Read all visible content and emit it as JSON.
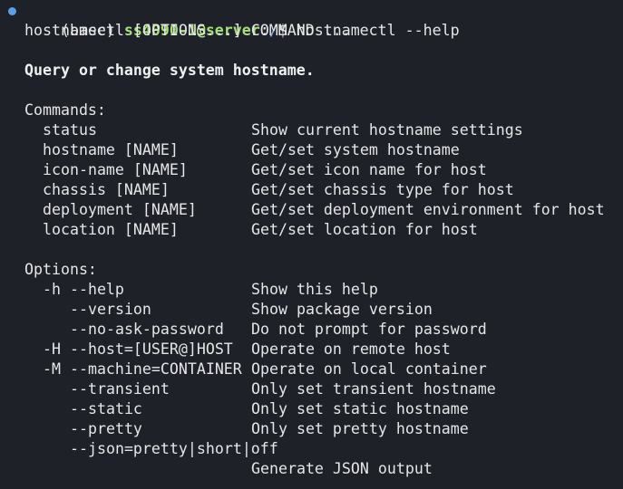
{
  "prompt": {
    "env": "(base) ",
    "user_host": "ss4090-1@server",
    "sep": ":",
    "path": "/",
    "symbol": "$ ",
    "command": "hostnamectl --help"
  },
  "usage": "hostnamectl [OPTIONS...] COMMAND ...",
  "summary": "Query or change system hostname.",
  "commands_header": "Commands:",
  "commands": [
    {
      "name": "status",
      "desc": "Show current hostname settings"
    },
    {
      "name": "hostname [NAME]",
      "desc": "Get/set system hostname"
    },
    {
      "name": "icon-name [NAME]",
      "desc": "Get/set icon name for host"
    },
    {
      "name": "chassis [NAME]",
      "desc": "Get/set chassis type for host"
    },
    {
      "name": "deployment [NAME]",
      "desc": "Get/set deployment environment for host"
    },
    {
      "name": "location [NAME]",
      "desc": "Get/set location for host"
    }
  ],
  "options_header": "Options:",
  "options": [
    {
      "name": "-h --help",
      "desc": "Show this help"
    },
    {
      "name": "--version",
      "desc": "Show package version"
    },
    {
      "name": "--no-ask-password",
      "desc": "Do not prompt for password"
    },
    {
      "name": "-H --host=[USER@]HOST",
      "desc": "Operate on remote host"
    },
    {
      "name": "-M --machine=CONTAINER",
      "desc": "Operate on local container"
    },
    {
      "name": "--transient",
      "desc": "Only set transient hostname"
    },
    {
      "name": "--static",
      "desc": "Only set static hostname"
    },
    {
      "name": "--pretty",
      "desc": "Only set pretty hostname"
    },
    {
      "name": "--json=pretty|short|off",
      "desc": ""
    },
    {
      "name": "",
      "desc": "Generate JSON output"
    }
  ],
  "colors": {
    "background": "#1e2128",
    "text": "#e6e6e6",
    "user_host": "#a6e07a",
    "path": "#7aa8f0",
    "status_dot": "#5aa0e6"
  }
}
